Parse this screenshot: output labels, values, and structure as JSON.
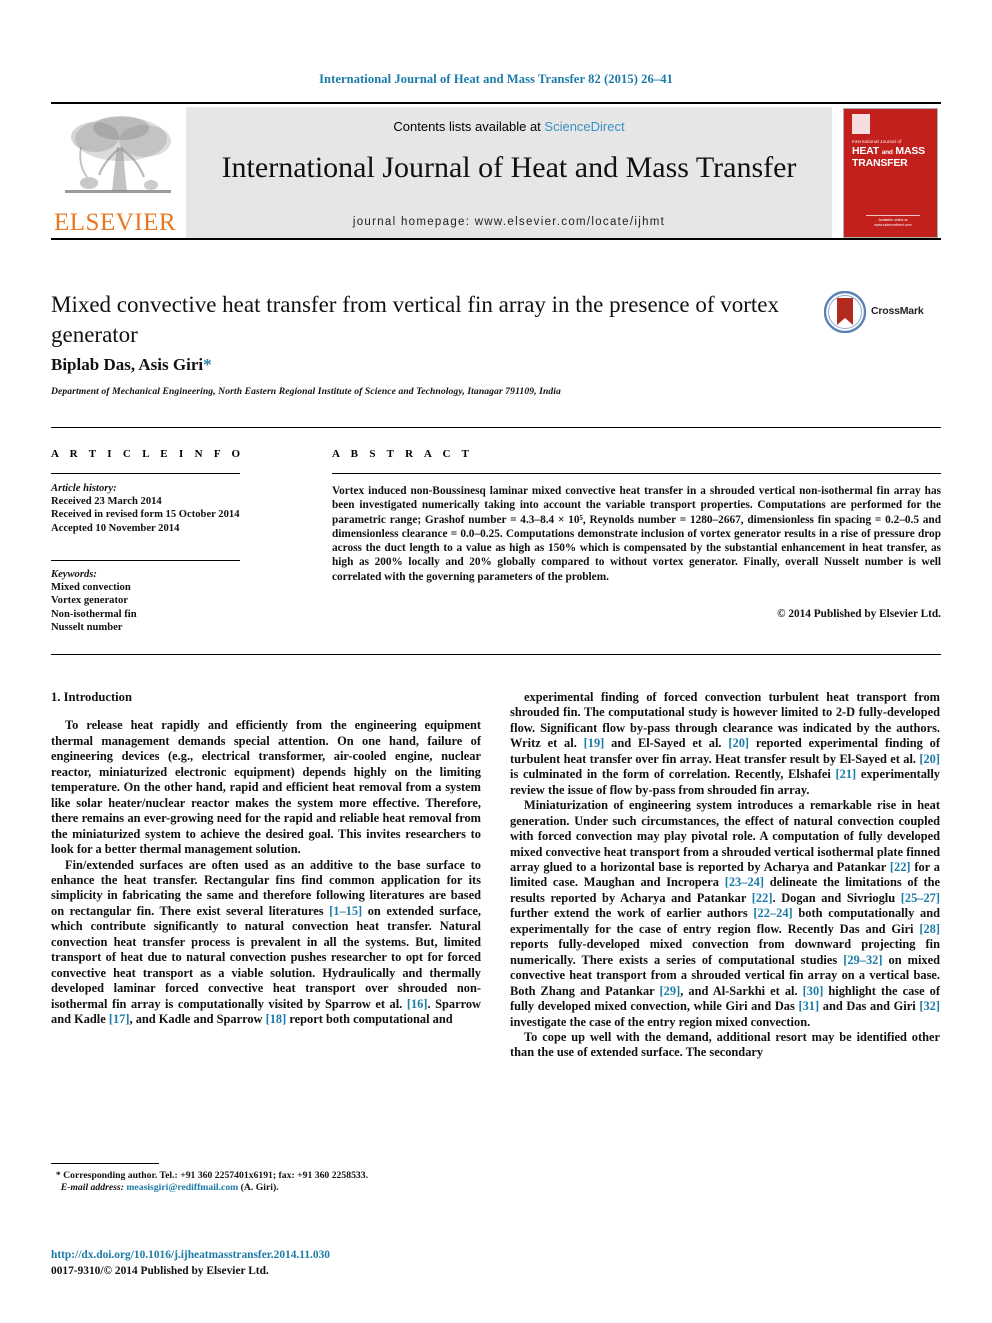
{
  "running_head": "International Journal of Heat and Mass Transfer 82 (2015) 26–41",
  "masthead": {
    "publisher_name": "ELSEVIER",
    "contents_prefix": "Contents lists available at ",
    "sciencedirect": "ScienceDirect",
    "journal_title": "International Journal of Heat and Mass Transfer",
    "homepage": "journal homepage: www.elsevier.com/locate/ijhmt",
    "cover": {
      "line_small": "International Journal of",
      "line_big_1": "HEAT",
      "line_big_and": "and",
      "line_big_2": "MASS",
      "line_big_3": "TRANSFER",
      "footer": "Available online at www.sciencedirect.com"
    },
    "accent_red": "#c1201c",
    "accent_orange": "#E87722",
    "link_blue": "#3d8fc4"
  },
  "article": {
    "title": "Mixed convective heat transfer from vertical fin array in the presence of vortex generator",
    "authors": "Biplab Das, Asis Giri",
    "corresponding_marker": "*",
    "affiliation": "Department of Mechanical Engineering, North Eastern Regional Institute of Science and Technology, Itanagar 791109, India",
    "crossmark_label": "CrossMark"
  },
  "info": {
    "heading": "A R T I C L E   I N F O",
    "history_label": "Article history:",
    "history": [
      "Received 23 March 2014",
      "Received in revised form 15 October 2014",
      "Accepted 10 November 2014"
    ],
    "keywords_label": "Keywords:",
    "keywords": [
      "Mixed convection",
      "Vortex generator",
      "Non-isothermal fin",
      "Nusselt number"
    ]
  },
  "abstract": {
    "heading": "A B S T R A C T",
    "body": "Vortex induced non-Boussinesq laminar mixed convective heat transfer in a shrouded vertical non-isothermal fin array has been investigated numerically taking into account the variable transport properties. Computations are performed for the parametric range; Grashof number = 4.3–8.4 × 10⁵, Reynolds number = 1280–2667, dimensionless fin spacing = 0.2–0.5 and dimensionless clearance = 0.0–0.25. Computations demonstrate inclusion of vortex generator results in a rise of pressure drop across the duct length to a value as high as 150% which is compensated by the substantial enhancement in heat transfer, as high as 200% locally and 20% globally compared to without vortex generator. Finally, overall Nusselt number is well correlated with the governing parameters of the problem.",
    "copyright": "© 2014 Published by Elsevier Ltd."
  },
  "body": {
    "section_heading": "1. Introduction",
    "left_paragraphs": [
      "To release heat rapidly and efficiently from the engineering equipment thermal management demands special attention. On one hand, failure of engineering devices (e.g., electrical transformer, air-cooled engine, nuclear reactor, miniaturized electronic equipment) depends highly on the limiting temperature. On the other hand, rapid and efficient heat removal from a system like solar heater/nuclear reactor makes the system more effective. Therefore, there remains an ever-growing need for the rapid and reliable heat removal from the miniaturized system to achieve the desired goal. This invites researchers to look for a better thermal management solution."
    ],
    "left_para2_parts": [
      "Fin/extended surfaces are often used as an additive to the base surface to enhance the heat transfer. Rectangular fins find common application for its simplicity in fabricating the same and therefore following literatures are based on rectangular fin. There exist several literatures ",
      "[1–15]",
      " on extended surface, which contribute significantly to natural convection heat transfer. Natural convection heat transfer process is prevalent in all the systems. But, limited transport of heat due to natural convection pushes researcher to opt for forced convective heat transport as a viable solution. Hydraulically and thermally developed laminar forced convective heat transport over shrouded non-isothermal fin array is computationally visited by Sparrow et al. ",
      "[16]",
      ". Sparrow and Kadle ",
      "[17]",
      ", and Kadle and Sparrow ",
      "[18]",
      " report both computational and"
    ],
    "right_para1_parts": [
      "experimental finding of forced convection turbulent heat transport from shrouded fin. The computational study is however limited to 2-D fully-developed flow. Significant flow by-pass through clearance was indicated by the authors. Writz et al. ",
      "[19]",
      " and El-Sayed et al. ",
      "[20]",
      " reported experimental finding of turbulent heat transfer over fin array. Heat transfer result by El-Sayed et al. ",
      "[20]",
      " is culminated in the form of correlation. Recently, Elshafei ",
      "[21]",
      " experimentally review the issue of flow by-pass from shrouded fin array."
    ],
    "right_para2_parts": [
      "Miniaturization of engineering system introduces a remarkable rise in heat generation. Under such circumstances, the effect of natural convection coupled with forced convection may play pivotal role. A computation of fully developed mixed convective heat transport from a shrouded vertical isothermal plate finned array glued to a horizontal base is reported by Acharya and Patankar ",
      "[22]",
      " for a limited case. Maughan and Incropera ",
      "[23–24]",
      " delineate the limitations of the results reported by Acharya and Patankar ",
      "[22]",
      ". Dogan and Sivrioglu ",
      "[25–27]",
      " further extend the work of earlier authors ",
      "[22–24]",
      " both computationally and experimentally for the case of entry region flow. Recently Das and Giri ",
      "[28]",
      " reports fully-developed mixed convection from downward projecting fin numerically. There exists a series of computational studies ",
      "[29–32]",
      " on mixed convective heat transport from a shrouded vertical fin array on a vertical base. Both Zhang and Patankar ",
      "[29]",
      ", and Al-Sarkhi et al. ",
      "[30]",
      " highlight the case of fully developed mixed convection, while Giri and Das ",
      "[31]",
      " and Das and Giri ",
      "[32]",
      " investigate the case of the entry region mixed convection."
    ],
    "right_para3": "To cope up well with the demand, additional resort may be identified other than the use of extended surface. The secondary"
  },
  "footnote": {
    "marker": "*",
    "corresponding": "Corresponding author. Tel.: +91 360 2257401x6191; fax: +91 360 2258533.",
    "email_label": "E-mail address:",
    "email": "measisgiri@rediffmail.com",
    "email_suffix": "(A. Giri)."
  },
  "footer": {
    "doi": "http://dx.doi.org/10.1016/j.ijheatmasstransfer.2014.11.030",
    "issn_line": "0017-9310/© 2014 Published by Elsevier Ltd."
  }
}
